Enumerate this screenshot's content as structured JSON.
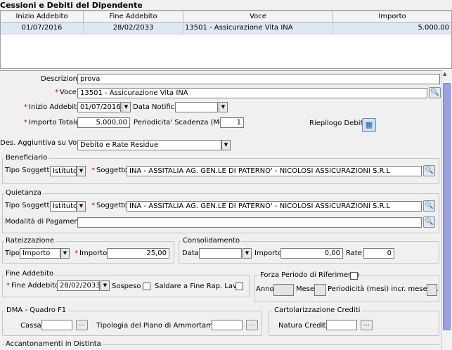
{
  "title": "Cessioni e Debiti del Dipendente",
  "grid": {
    "columns": [
      "Inizio Addebito",
      "Fine Addebito",
      "Voce",
      "Importo"
    ],
    "rows": [
      [
        "01/07/2016",
        "28/02/2033",
        "13501   -   Assicurazione Vita INA",
        "5.000,00"
      ]
    ]
  },
  "form": {
    "descrizione_label": "Descrizione",
    "descrizione": "prova",
    "voce_label": "Voce",
    "voce": "13501   -   Assicurazione Vita INA",
    "inizio_label": "Inizio Addebito",
    "inizio": "01/07/2016",
    "data_notifica_label": "Data Notifica",
    "data_notifica": "",
    "importo_totale_label": "Importo Totale",
    "importo_totale": "5.000,00",
    "periodicita_label": "Periodicita' Scadenza (Mesi)",
    "periodicita": "1",
    "riepilogo_label": "Riepilogo Debito",
    "des_label": "Des. Aggiuntiva su Voce",
    "des": "Debito e Rate Residue"
  },
  "beneficiario": {
    "title": "Beneficiario",
    "tipo_label": "Tipo Soggetto",
    "tipo": "Istituto",
    "soggetto_label": "Soggetto",
    "soggetto": "INA - ASSITALIA AG. GEN.LE DI PATERNO' -  NICOLOSI ASSICURAZIONI S.R.L"
  },
  "quietanza": {
    "title": "Quietanza",
    "tipo_label": "Tipo Soggetto",
    "tipo": "Istituto",
    "soggetto_label": "Soggetto",
    "soggetto": "INA - ASSITALIA AG. GEN.LE DI PATERNO' -  NICOLOSI ASSICURAZIONI S.R.L",
    "modalita_label": "Modalità di Pagamento",
    "modalita": ""
  },
  "rateizzazione": {
    "title": "Rateizzazione",
    "tipo_label": "Tipo",
    "tipo": "Importo",
    "importo_label": "Importo",
    "importo": "25,00"
  },
  "consolidamento": {
    "title": "Consolidamento",
    "data_label": "Data",
    "data": "",
    "importo_label": "Importo",
    "importo": "0,00",
    "rate_label": "Rate",
    "rate": "0"
  },
  "fine_addebito": {
    "title": "Fine Addebito",
    "fine_label": "Fine Addebito",
    "fine": "28/02/2033",
    "sospeso_label": "Sospeso",
    "saldare_label": "Saldare a Fine Rap. Lav."
  },
  "forza": {
    "title": "Forza Periodo di Riferimento",
    "anno_label": "Anno",
    "mese_label": "Mese",
    "periodicita_label": "Periodicità (mesi) incr. mese rif."
  },
  "dma": {
    "title": "DMA - Quadro F1",
    "cassa_label": "Cassa",
    "tipologia_label": "Tipologia del Piano di Ammortamento"
  },
  "cartolarizzazione": {
    "title": "Cartolarizzazione Crediti",
    "natura_label": "Natura Credito"
  },
  "accantonamenti": {
    "title": "Accantonamenti in Distinta"
  },
  "icons": {
    "search": "magnifier-icon",
    "dropdown": "chevron-down-icon",
    "ellipsis": "ellipsis-icon",
    "riepilogo": "calculator-icon"
  }
}
